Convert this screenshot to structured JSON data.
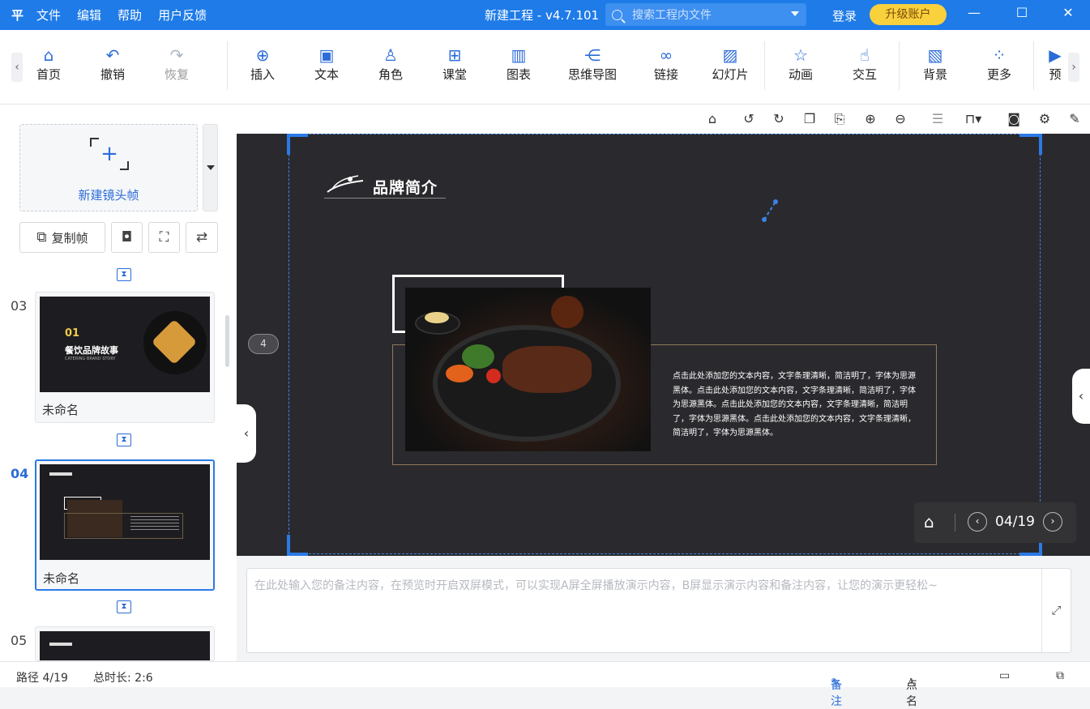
{
  "titlebar": {
    "logo": "平",
    "menu": [
      "文件",
      "编辑",
      "帮助",
      "用户反馈"
    ],
    "title": "新建工程 - v4.7.101",
    "search_placeholder": "搜索工程内文件",
    "login": "登录",
    "upgrade": "升级账户",
    "window_controls": [
      "minimize-icon",
      "maximize-icon",
      "close-icon"
    ]
  },
  "toolbar": {
    "items": [
      {
        "label": "首页",
        "icon": "home-icon",
        "enabled": true
      },
      {
        "label": "撤销",
        "icon": "undo-icon",
        "enabled": true
      },
      {
        "label": "恢复",
        "icon": "redo-icon",
        "enabled": false
      },
      {
        "label": "插入",
        "icon": "plus-circle-icon",
        "enabled": true
      },
      {
        "label": "文本",
        "icon": "text-icon",
        "enabled": true
      },
      {
        "label": "角色",
        "icon": "character-icon",
        "enabled": true
      },
      {
        "label": "课堂",
        "icon": "classroom-icon",
        "enabled": true
      },
      {
        "label": "图表",
        "icon": "chart-icon",
        "enabled": true
      },
      {
        "label": "思维导图",
        "icon": "mindmap-icon",
        "enabled": true
      },
      {
        "label": "链接",
        "icon": "link-icon",
        "enabled": true
      },
      {
        "label": "幻灯片",
        "icon": "slide-icon",
        "enabled": true
      },
      {
        "label": "动画",
        "icon": "animation-icon",
        "enabled": true
      },
      {
        "label": "交互",
        "icon": "interaction-icon",
        "enabled": true
      },
      {
        "label": "背景",
        "icon": "background-icon",
        "enabled": true
      },
      {
        "label": "更多",
        "icon": "more-icon",
        "enabled": true
      },
      {
        "label": "预",
        "icon": "preview-icon",
        "enabled": true
      }
    ]
  },
  "sidebar": {
    "new_frame": "新建镜头帧",
    "copy_frame": "复制帧",
    "slides": [
      {
        "number": "03",
        "name": "未命名",
        "active": false,
        "thumb_title": "01",
        "thumb_subtitle": "餐饮品牌故事",
        "thumb_en": "CATERING BRAND STORY"
      },
      {
        "number": "04",
        "name": "未命名",
        "active": true
      },
      {
        "number": "05",
        "name": "",
        "active": false
      }
    ]
  },
  "canvas": {
    "frame_badge": "4",
    "slide_title": "品牌简介",
    "body_text": "点击此处添加您的文本内容，文字条理清晰，简洁明了，字体为思源黑体。点击此处添加您的文本内容，文字条理清晰，简洁明了，字体为思源黑体。点击此处添加您的文本内容，文字条理清晰，简洁明了，字体为思源黑体。点击此处添加您的文本内容，文字条理清晰，简洁明了，字体为思源黑体。",
    "page_indicator": "04/19"
  },
  "notes": {
    "placeholder": "在此处输入您的备注内容，在预览时开启双屏模式，可以实现A屏全屏播放演示内容，B屏显示演示内容和备注内容，让您的演示更轻松~"
  },
  "status": {
    "path": "路径 4/19",
    "duration": "总时长: 2:6",
    "notes_btn": "备注",
    "rollcall_btn": "点名"
  },
  "colors": {
    "accent": "#1e7be8",
    "upgrade": "#f9d13c",
    "stage_bg": "#2a2a2e"
  }
}
